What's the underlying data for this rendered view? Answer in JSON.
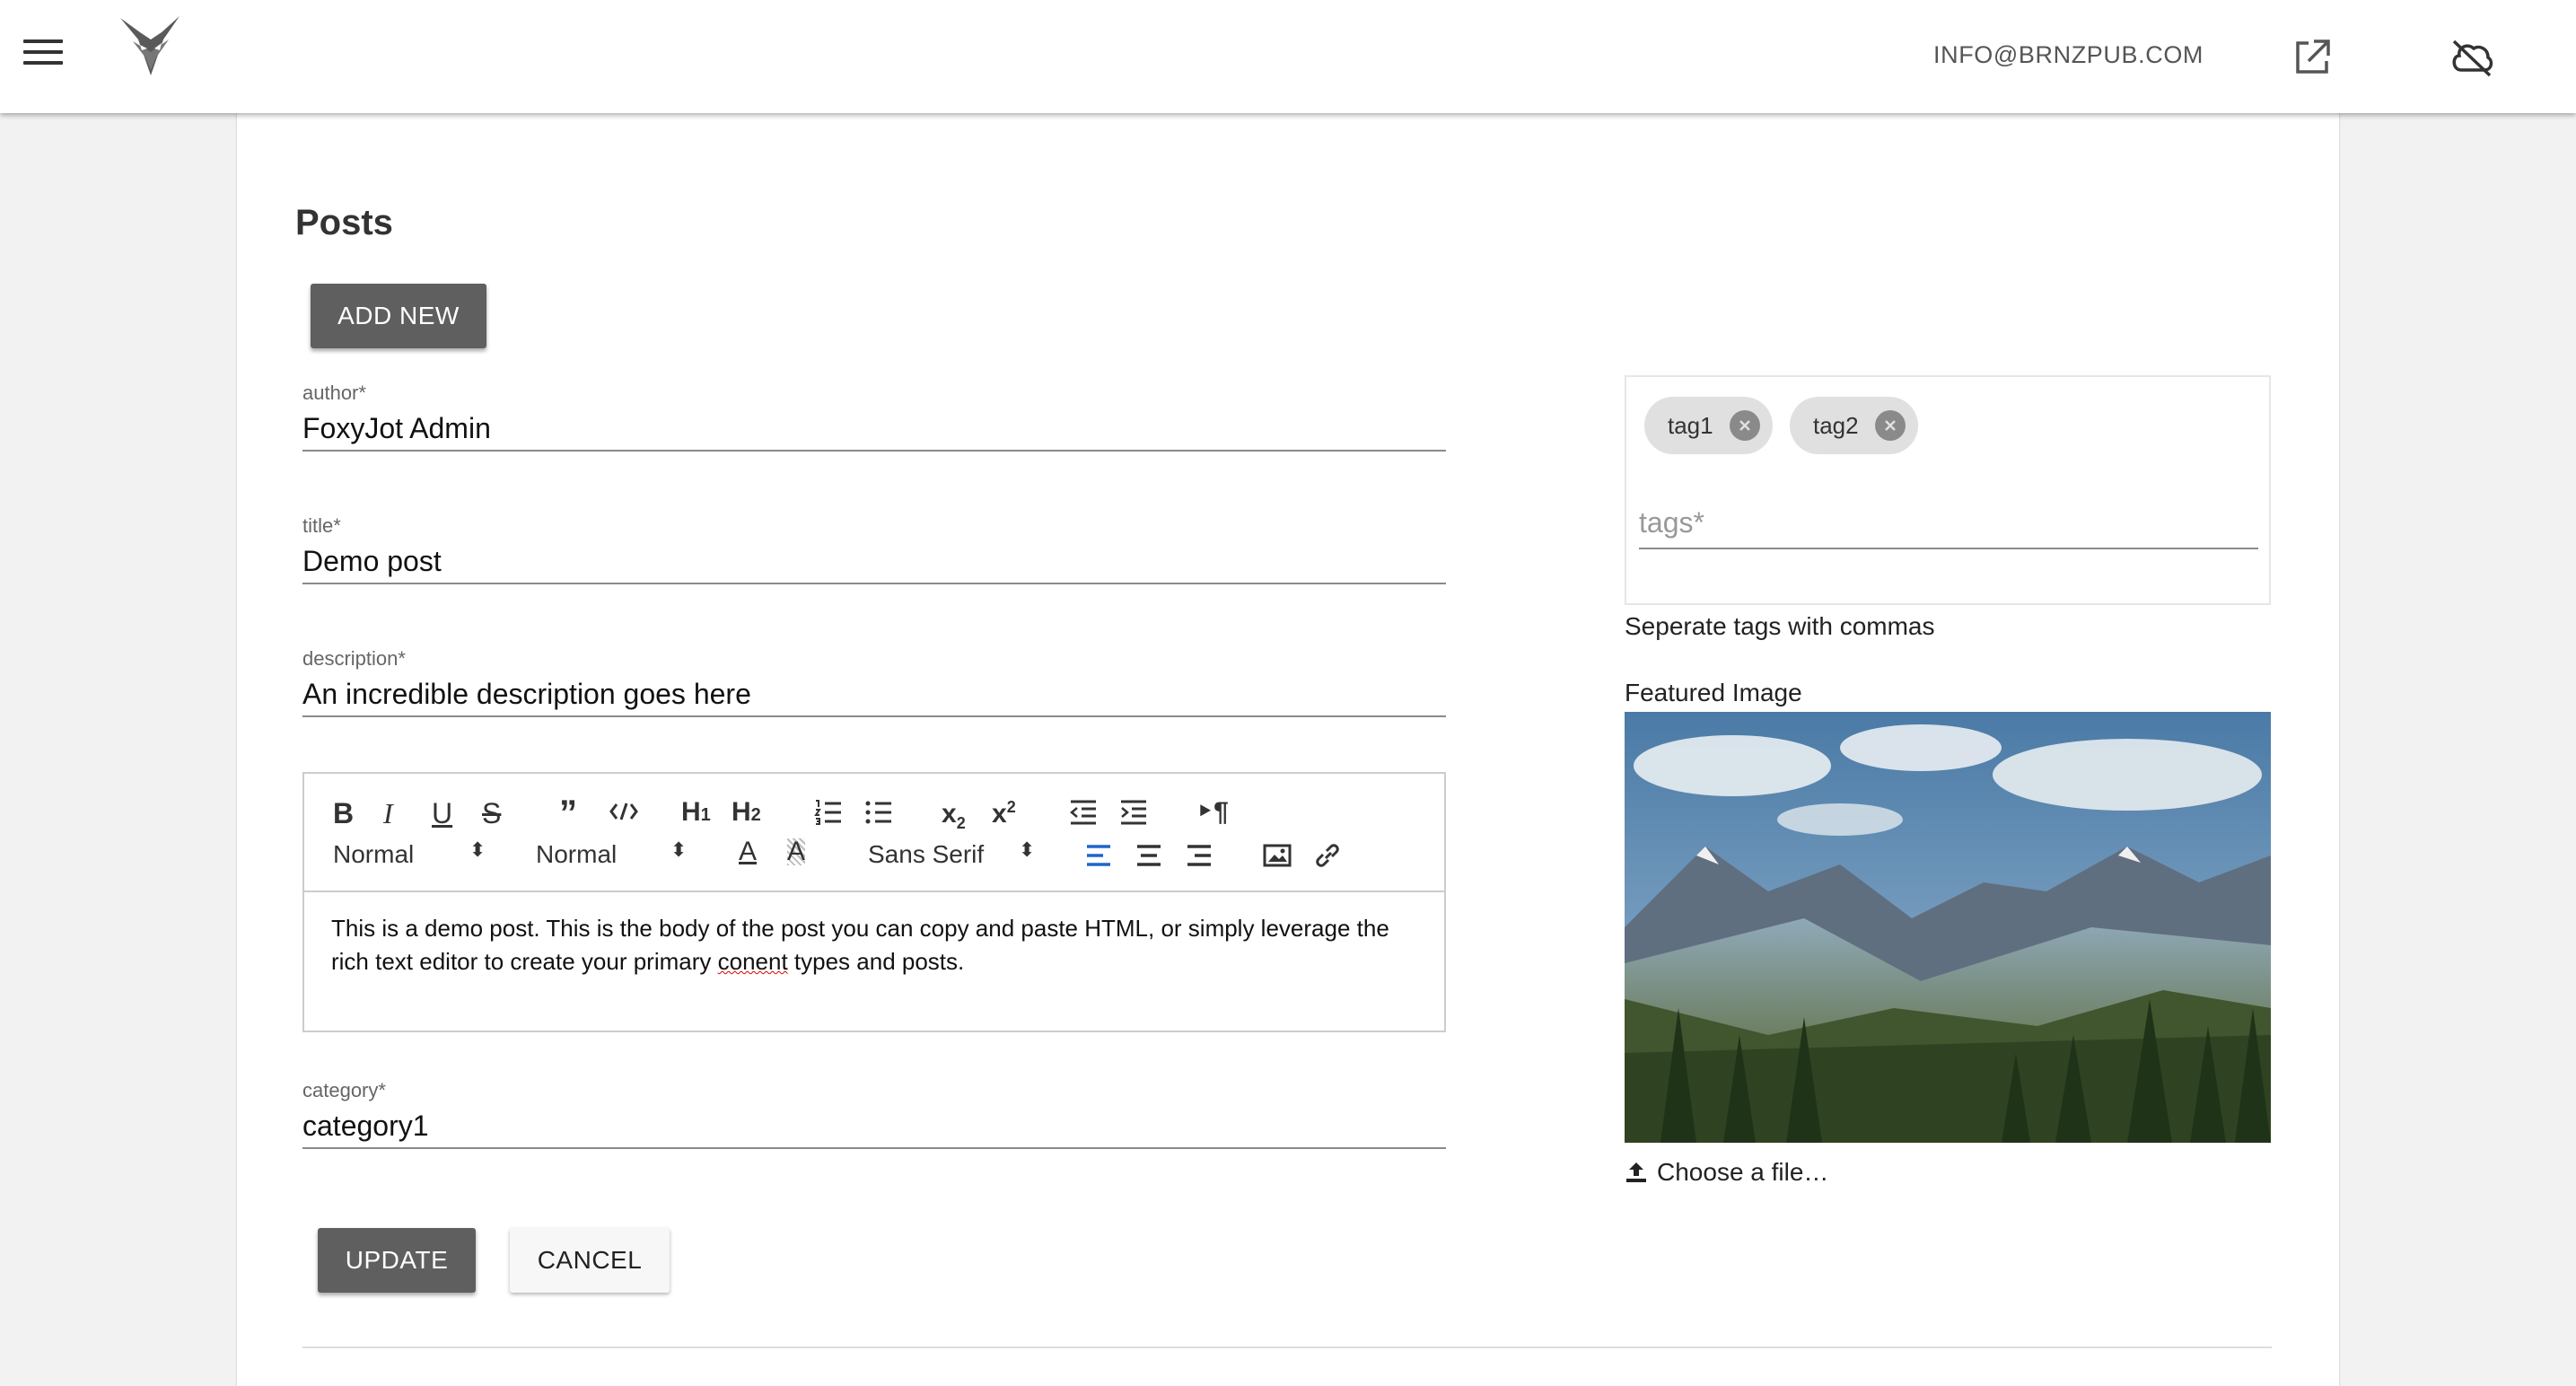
{
  "appbar": {
    "email": "INFO@BRNZPUB.COM",
    "icons": [
      "menu-icon",
      "fox-logo",
      "external-link-icon",
      "cloud-off-icon"
    ]
  },
  "page": {
    "title": "Posts",
    "add_new_label": "ADD NEW"
  },
  "form": {
    "author": {
      "label": "author*",
      "value": "FoxyJot Admin"
    },
    "title": {
      "label": "title*",
      "value": "Demo post"
    },
    "description": {
      "label": "description*",
      "value": "An incredible description goes here"
    },
    "category": {
      "label": "category*",
      "value": "category1"
    }
  },
  "editor": {
    "header_select": "Normal",
    "size_select": "Normal",
    "font_select": "Sans Serif",
    "body_part1": "This is a demo post. This is the body of the post you can copy and paste HTML, or simply leverage the rich text editor to create your primary ",
    "body_misspelled": "conent",
    "body_part2": " types and posts."
  },
  "tags": {
    "chips": [
      "tag1",
      "tag2"
    ],
    "placeholder": "tags*",
    "helper": "Seperate tags with commas"
  },
  "featured": {
    "label": "Featured Image",
    "choose_label": "Choose a file…"
  },
  "actions": {
    "update_label": "UPDATE",
    "cancel_label": "CANCEL"
  },
  "colors": {
    "primary_button": "#5f5f5f",
    "active_align": "#1e66c8"
  }
}
